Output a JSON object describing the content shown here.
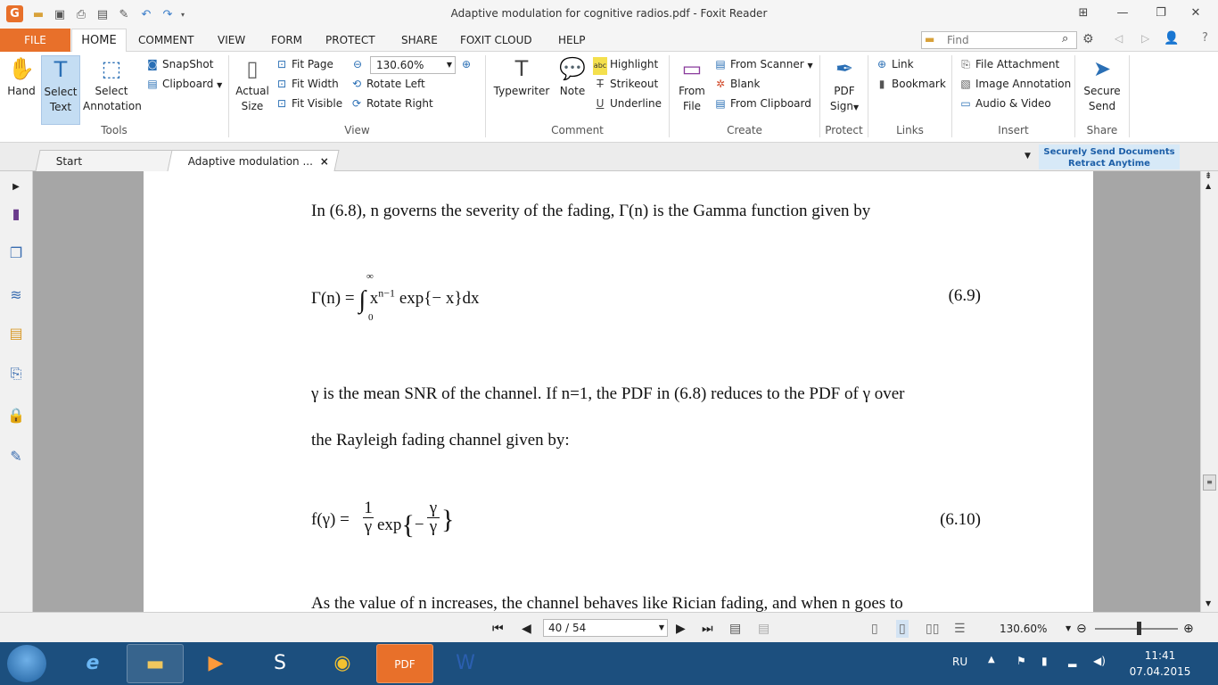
{
  "window": {
    "title": "Adaptive modulation for cognitive radios.pdf - Foxit Reader",
    "app_logo": "G",
    "accent": "#e8702a"
  },
  "menubar": {
    "items": [
      "FILE",
      "HOME",
      "COMMENT",
      "VIEW",
      "FORM",
      "PROTECT",
      "SHARE",
      "FOXIT CLOUD",
      "HELP"
    ],
    "find_placeholder": "Find"
  },
  "ribbon": {
    "tools": {
      "hand": "Hand",
      "select_text_l1": "Select",
      "select_text_l2": "Text",
      "select_annotation_l1": "Select",
      "select_annotation_l2": "Annotation",
      "snapshot": "SnapShot",
      "clipboard": "Clipboard",
      "label": "Tools"
    },
    "view": {
      "actual_size_l1": "Actual",
      "actual_size_l2": "Size",
      "fit_page": "Fit Page",
      "fit_width": "Fit Width",
      "fit_visible": "Fit Visible",
      "zoom": "130.60%",
      "rotate_left": "Rotate Left",
      "rotate_right": "Rotate Right",
      "label": "View"
    },
    "comment": {
      "typewriter": "Typewriter",
      "note": "Note",
      "highlight": "Highlight",
      "strikeout": "Strikeout",
      "underline": "Underline",
      "label": "Comment"
    },
    "create": {
      "from_file_l1": "From",
      "from_file_l2": "File",
      "from_scanner": "From Scanner",
      "blank": "Blank",
      "from_clipboard": "From Clipboard",
      "label": "Create"
    },
    "protect": {
      "pdf_sign_l1": "PDF",
      "pdf_sign_l2": "Sign",
      "label": "Protect"
    },
    "links": {
      "link": "Link",
      "bookmark": "Bookmark",
      "label": "Links"
    },
    "insert": {
      "file_attachment": "File Attachment",
      "image_annotation": "Image Annotation",
      "audio_video": "Audio & Video",
      "label": "Insert"
    },
    "share": {
      "secure_send_l1": "Secure",
      "secure_send_l2": "Send",
      "label": "Share"
    }
  },
  "tabs": {
    "start": "Start",
    "document": "Adaptive modulation ...",
    "close": "×",
    "banner_l1": "Securely Send Documents",
    "banner_l2": "Retract Anytime"
  },
  "document": {
    "line1": "In (6.8), n governs the severity of the fading, Γ(n) is the Gamma function given by",
    "eq1_lhs": "Γ(n) = ",
    "eq1_integral_top": "∞",
    "eq1_integral_bottom": "0",
    "eq1_body": "x",
    "eq1_exp": "n−1",
    "eq1_rest": " exp{− x}dx",
    "eq1_num": "(6.9)",
    "line2": "γ is the mean SNR of the channel. If n=1, the PDF in (6.8) reduces to the PDF of γ over",
    "line3": "the Rayleigh fading channel given by:",
    "eq2_lhs": "f(γ) = ",
    "eq2_num_top": "1",
    "eq2_num_bottom": "γ",
    "eq2_exp": "exp",
    "eq2_frac_top": "γ",
    "eq2_frac_bottom": "γ",
    "eq2_num": "(6.10)",
    "line4": "As the value of n increases, the channel behaves like Rician fading, and when n goes to"
  },
  "statusbar": {
    "page": "40 / 54",
    "zoom": "130.60%"
  },
  "taskbar": {
    "lang": "RU",
    "time": "11:41",
    "date": "07.04.2015"
  }
}
